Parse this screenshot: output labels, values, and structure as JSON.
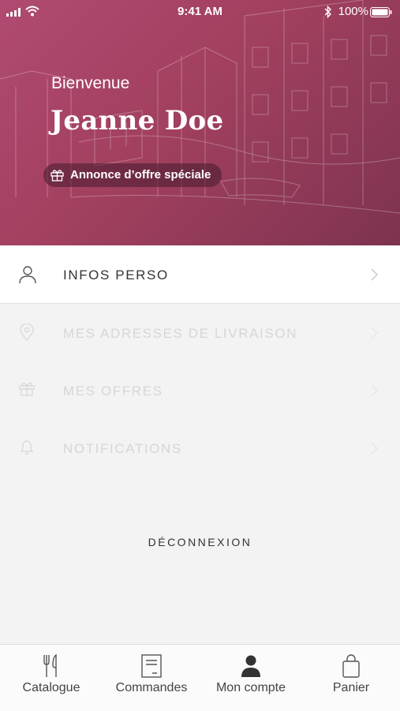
{
  "status_bar": {
    "time": "9:41 AM",
    "battery": "100%"
  },
  "hero": {
    "greeting": "Bienvenue",
    "user_name": "Jeanne Doe",
    "offer_badge": "Annonce d’offre spéciale"
  },
  "menu": {
    "items": [
      {
        "label": "INFOS PERSO",
        "icon": "user-icon",
        "state": "active"
      },
      {
        "label": "MES ADRESSES DE LIVRAISON",
        "icon": "location-pin-icon",
        "state": "disabled"
      },
      {
        "label": "MES OFFRES",
        "icon": "gift-icon",
        "state": "disabled"
      },
      {
        "label": "NOTIFICATIONS",
        "icon": "bell-icon",
        "state": "disabled"
      }
    ],
    "logout_label": "DÉCONNEXION"
  },
  "tabbar": {
    "tabs": [
      {
        "label": "Catalogue",
        "icon": "fork-knife-icon",
        "selected": false
      },
      {
        "label": "Commandes",
        "icon": "receipt-icon",
        "selected": false
      },
      {
        "label": "Mon compte",
        "icon": "person-icon",
        "selected": true
      },
      {
        "label": "Panier",
        "icon": "shopping-bag-icon",
        "selected": false
      }
    ]
  },
  "colors": {
    "hero_gradient_start": "#b04a72",
    "hero_gradient_end": "#7d3350",
    "menu_disabled": "#d6d6d6"
  }
}
